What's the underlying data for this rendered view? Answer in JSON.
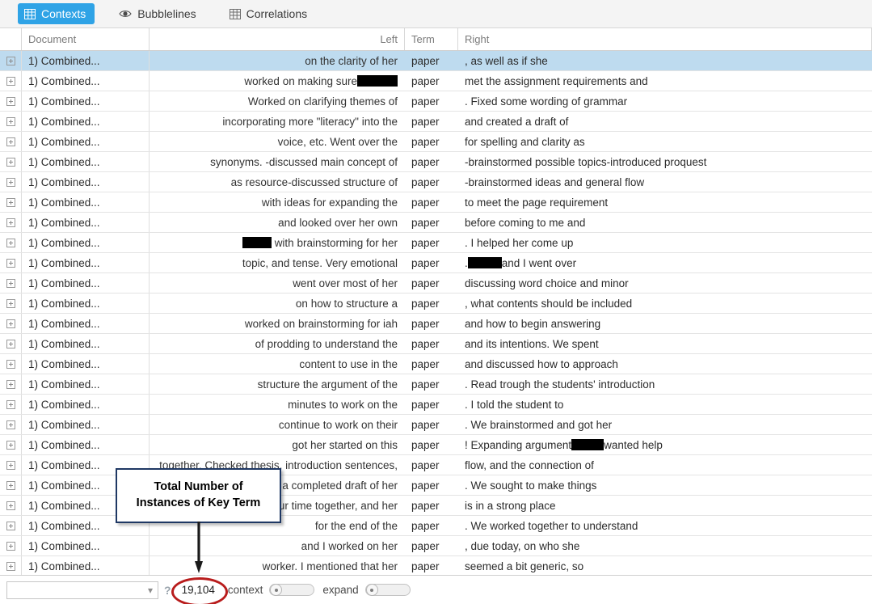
{
  "tabs": [
    {
      "label": "Contexts",
      "icon": "table-grid-icon",
      "active": true
    },
    {
      "label": "Bubblelines",
      "icon": "eye-icon",
      "active": false
    },
    {
      "label": "Correlations",
      "icon": "table-grid-icon",
      "active": false
    }
  ],
  "table": {
    "columns": [
      "Document",
      "Left",
      "Term",
      "Right"
    ],
    "rows": [
      {
        "doc": "1) Combined...",
        "left": "on the clarity of her",
        "left_redact": 0,
        "term": "paper",
        "right": ", as well as if she",
        "right_redact": 0,
        "selected": true
      },
      {
        "doc": "1) Combined...",
        "left": "worked on making sure ",
        "left_redact": 50,
        "term": "paper",
        "right": "met the assignment requirements and",
        "right_redact": 0,
        "selected": false
      },
      {
        "doc": "1) Combined...",
        "left": "Worked on clarifying themes of",
        "left_redact": 0,
        "term": "paper",
        "right": ". Fixed some wording of grammar",
        "right_redact": 0,
        "selected": false
      },
      {
        "doc": "1) Combined...",
        "left": "incorporating more \"literacy\" into the",
        "left_redact": 0,
        "term": "paper",
        "right": "and created a draft of",
        "right_redact": 0,
        "selected": false
      },
      {
        "doc": "1) Combined...",
        "left": "voice, etc. Went over the",
        "left_redact": 0,
        "term": "paper",
        "right": "for spelling and clarity as",
        "right_redact": 0,
        "selected": false
      },
      {
        "doc": "1) Combined...",
        "left": "synonyms. -discussed main concept of",
        "left_redact": 0,
        "term": "paper",
        "right": "-brainstormed possible topics-introduced proquest",
        "right_redact": 0,
        "selected": false
      },
      {
        "doc": "1) Combined...",
        "left": "as resource-discussed structure of",
        "left_redact": 0,
        "term": "paper",
        "right": "-brainstormed ideas and general flow",
        "right_redact": 0,
        "selected": false
      },
      {
        "doc": "1) Combined...",
        "left": "with ideas for expanding the",
        "left_redact": 0,
        "term": "paper",
        "right": "to meet the page requirement",
        "right_redact": 0,
        "selected": false
      },
      {
        "doc": "1) Combined...",
        "left": "and looked over her own",
        "left_redact": 0,
        "term": "paper",
        "right": "before coming to me and",
        "right_redact": 0,
        "selected": false
      },
      {
        "doc": "1) Combined...",
        "left": "with brainstorming for her",
        "left_redact": 36,
        "left_redact_pos": "before",
        "term": "paper",
        "right": ". I helped her come up",
        "right_redact": 0,
        "selected": false
      },
      {
        "doc": "1) Combined...",
        "left": "topic, and tense. Very emotional",
        "left_redact": 0,
        "term": "paper",
        "right": ". and I went over",
        "right_redact": 42,
        "right_redact_pos": "after-1",
        "selected": false
      },
      {
        "doc": "1) Combined...",
        "left": "went over most of her",
        "left_redact": 0,
        "term": "paper",
        "right": "discussing word choice and minor",
        "right_redact": 0,
        "selected": false
      },
      {
        "doc": "1) Combined...",
        "left": "on how to structure a",
        "left_redact": 0,
        "term": "paper",
        "right": ", what contents should be included",
        "right_redact": 0,
        "selected": false
      },
      {
        "doc": "1) Combined...",
        "left": "worked on brainstorming for iah",
        "left_redact": 0,
        "term": "paper",
        "right": "and how to begin answering",
        "right_redact": 0,
        "selected": false
      },
      {
        "doc": "1) Combined...",
        "left": "of prodding to understand the",
        "left_redact": 0,
        "term": "paper",
        "right": "and its intentions. We spent",
        "right_redact": 0,
        "selected": false
      },
      {
        "doc": "1) Combined...",
        "left": "content to use in the",
        "left_redact": 0,
        "term": "paper",
        "right": "and discussed how to approach",
        "right_redact": 0,
        "selected": false
      },
      {
        "doc": "1) Combined...",
        "left": "structure the argument of the",
        "left_redact": 0,
        "term": "paper",
        "right": ". Read trough the students' introduction",
        "right_redact": 0,
        "selected": false
      },
      {
        "doc": "1) Combined...",
        "left": "minutes to work on the",
        "left_redact": 0,
        "term": "paper",
        "right": ". I told the student to",
        "right_redact": 0,
        "selected": false
      },
      {
        "doc": "1) Combined...",
        "left": "continue to work on their",
        "left_redact": 0,
        "term": "paper",
        "right": ". We brainstormed and got her",
        "right_redact": 0,
        "selected": false
      },
      {
        "doc": "1) Combined...",
        "left": "got her started on this",
        "left_redact": 0,
        "term": "paper",
        "right": "! Expanding argument  wanted help",
        "right_redact": 40,
        "right_redact_pos": "mid",
        "selected": false
      },
      {
        "doc": "1) Combined...",
        "left": "together. Checked thesis, introduction sentences,",
        "left_redact": 0,
        "term": "paper",
        "right": "flow, and the connection of",
        "right_redact": 0,
        "selected": false
      },
      {
        "doc": "1) Combined...",
        "left": "a completed draft of her",
        "left_redact": 0,
        "term": "paper",
        "right": ". We sought to make things",
        "right_redact": 0,
        "selected": false
      },
      {
        "doc": "1) Combined...",
        "left": "our time together, and her",
        "left_redact": 0,
        "term": "paper",
        "right": "is in a strong place",
        "right_redact": 0,
        "selected": false
      },
      {
        "doc": "1) Combined...",
        "left": "for the end of the",
        "left_redact": 0,
        "term": "paper",
        "right": ". We worked together to understand",
        "right_redact": 0,
        "selected": false
      },
      {
        "doc": "1) Combined...",
        "left": "and I worked on her",
        "left_redact": 0,
        "term": "paper",
        "right": ", due today, on who she",
        "right_redact": 0,
        "selected": false
      },
      {
        "doc": "1) Combined...",
        "left": "worker. I mentioned that her",
        "left_redact": 0,
        "term": "paper",
        "right": "seemed a bit generic, so",
        "right_redact": 0,
        "selected": false
      }
    ]
  },
  "toolbar": {
    "search_value": "",
    "search_placeholder": "",
    "help_glyph": "?",
    "instance_count": "19,104",
    "context_label": "context",
    "expand_label": "expand"
  },
  "annotation": {
    "line1": "Total Number of",
    "line2": "Instances of Key Term",
    "highlight_color": "#b81c1c",
    "box_border_color": "#1f3864"
  }
}
